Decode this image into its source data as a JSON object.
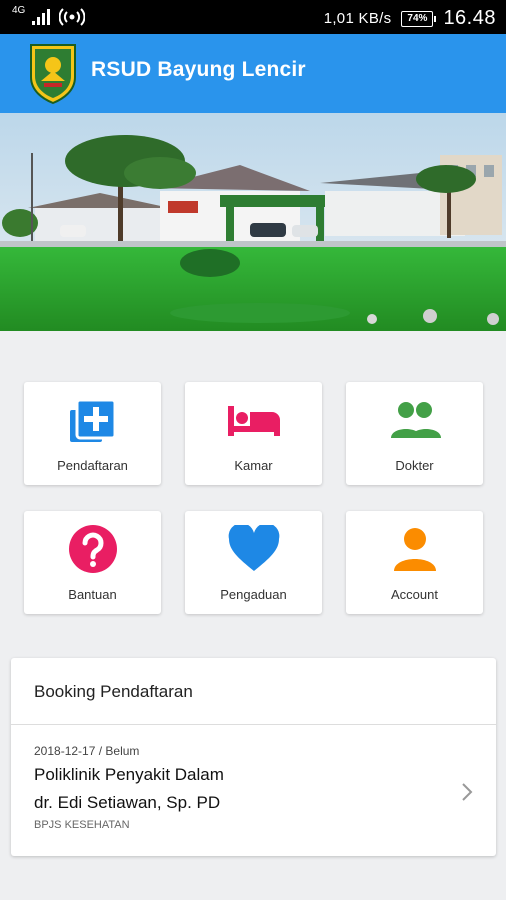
{
  "status_bar": {
    "network": "4G",
    "speed": "1,01 KB/s",
    "battery": "74%",
    "time": "16.48"
  },
  "app_bar": {
    "title": "RSUD Bayung Lencir"
  },
  "menu": [
    {
      "label": "Pendaftaran",
      "icon": "add-to-queue-icon",
      "color": "#1e88e5"
    },
    {
      "label": "Kamar",
      "icon": "bed-icon",
      "color": "#e91e63"
    },
    {
      "label": "Dokter",
      "icon": "people-icon",
      "color": "#43a047"
    },
    {
      "label": "Bantuan",
      "icon": "help-icon",
      "color": "#e91e63"
    },
    {
      "label": "Pengaduan",
      "icon": "heart-icon",
      "color": "#1e88e5"
    },
    {
      "label": "Account",
      "icon": "person-icon",
      "color": "#fb8c00"
    }
  ],
  "booking": {
    "title": "Booking Pendaftaran",
    "meta": "2018-12-17 / Belum",
    "clinic": "Poliklinik Penyakit Dalam",
    "doctor": "dr. Edi Setiawan, Sp. PD",
    "payer": "BPJS KESEHATAN"
  },
  "colors": {
    "app_bar": "#2a94ec",
    "background": "#eeeff1"
  }
}
